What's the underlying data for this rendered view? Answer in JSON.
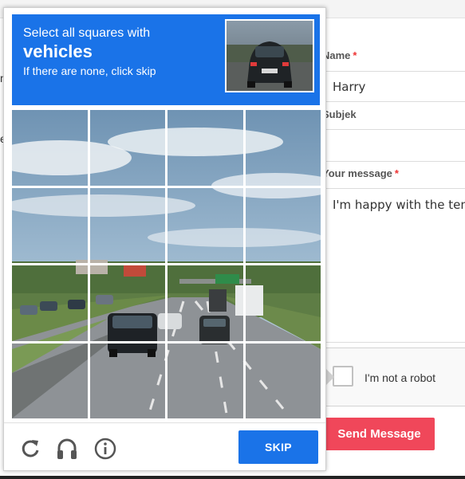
{
  "form": {
    "left_fragments": [
      "m",
      "e"
    ],
    "name_label": "Name",
    "name_required": "*",
    "name_value": "Harry",
    "subject_label": "Subjek",
    "subject_value": "",
    "message_label": "Your message",
    "message_required": "*",
    "message_value": "I'm happy with the temp",
    "recaptcha_label": "I'm not a robot",
    "send_label": "Send Message"
  },
  "challenge": {
    "instruction_line1": "Select all squares with",
    "target_word": "vehicles",
    "instruction_line3": "If there are none, click skip",
    "grid_rows": 4,
    "grid_cols": 4,
    "skip_label": "SKIP",
    "icons": {
      "reload": "reload-icon",
      "audio": "headphones-icon",
      "info": "info-icon"
    }
  },
  "colors": {
    "accent_blue": "#1a73e8",
    "send_red": "#f0475a",
    "required_red": "#e33333"
  }
}
